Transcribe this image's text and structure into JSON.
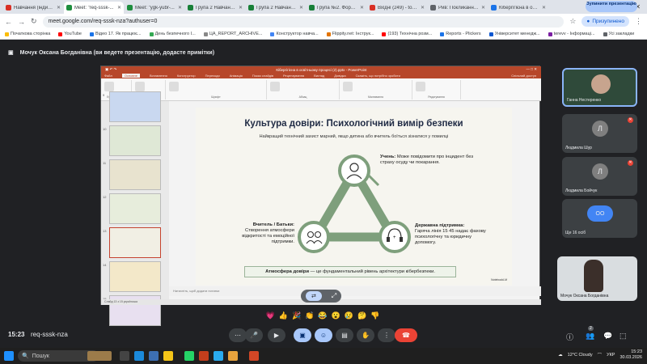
{
  "browser": {
    "tabs": [
      {
        "label": "Навчання (індивід...",
        "color": "#d93025",
        "active": false
      },
      {
        "label": "Meet: \"req-sssk-...",
        "color": "#1e8e3e",
        "active": true
      },
      {
        "label": "Meet: \"ygk-yubr-...",
        "color": "#1e8e3e",
        "active": false
      },
      {
        "label": "Група 2 Навчання (...",
        "color": "#188038",
        "active": false
      },
      {
        "label": "Група 2 Навчання (...",
        "color": "#188038",
        "active": false
      },
      {
        "label": "Група №2. Форма д...",
        "color": "#188038",
        "active": false
      },
      {
        "label": "Вхідні (249) - tokаp...",
        "color": "#d93025",
        "active": false
      },
      {
        "label": "Рив: Покликання на...",
        "color": "#5f6368",
        "active": false
      },
      {
        "label": "Кібергігієна в освіт...",
        "color": "#1a73e8",
        "active": false
      }
    ],
    "url": "meet.google.com/req-sssk-nza?authuser=0",
    "profile": "Призупинено",
    "bookmarks": [
      "Початкова сторінка",
      "YouTube",
      "Відео 17. Як працює...",
      "День безпечного І...",
      "ЦА_REPORT_ARCHIVE...",
      "Конструктор навча...",
      "Flippity.net: Інструк...",
      "(193) Технічна розм...",
      "Reports - Plickers",
      "Університет менедж...",
      "terevv - Інформаці...",
      "Усі закладки"
    ]
  },
  "banner": {
    "text": "Мочук Оксана Богданівна (ви ведете презентацію, додасте примітки)",
    "stop_label": "Зупинити презентацію"
  },
  "ppt": {
    "window_title": "Кібергігієна в освітньому процесі (2).pptx - PowerPoint",
    "menu": [
      "Файл",
      "Основне",
      "Вставлення",
      "Конструктор",
      "Переходи",
      "Анімація",
      "Показ слайдів",
      "Рецензування",
      "Вигляд",
      "Довідка"
    ],
    "search_label": "Скажіть, що потрібно зробити",
    "share_label": "Спільний доступ",
    "ribbon_groups": [
      "Буфер обміну",
      "Слайди",
      "Шрифт",
      "Абзац",
      "Малювання",
      "Редагування"
    ],
    "slide_nums": [
      "9",
      "10",
      "11",
      "12",
      "13",
      "14",
      "15"
    ],
    "notes": "Натисніть, щоб додати нотатки",
    "status": "Слайд 13 з 15   українська"
  },
  "slide": {
    "title": "Культура довіри: Психологічний вимір безпеки",
    "subtitle": "Найкращий технічний захист марний, якщо дитина або вчитель боїться зізнатися у помилці",
    "student_title": "Учень:",
    "student_text": " Може повідомити про інцидент без страху осуду чи покарання.",
    "teacher_title": "Вчитель / Батьки:",
    "teacher_text": "Створення атмосфери відкритості та емоційної підтримки.",
    "state_title": "Державна підтримка:",
    "state_text": "Гаряча лінія 15 45 надає фахову психологічну та юридичну допомогу.",
    "bottom_bold": "Атмосфера довіри",
    "bottom_text": " — це фундаментальний рівень архітектури кібербезпеки.",
    "watermark": "NotebookLM"
  },
  "participants": [
    {
      "name": "Ганна Нестеренко",
      "initial": "",
      "muted": false,
      "video": true
    },
    {
      "name": "Людмила Шур",
      "initial": "Л",
      "muted": true,
      "video": false
    },
    {
      "name": "Людмила Бойчук",
      "initial": "Л",
      "muted": true,
      "video": false
    },
    {
      "name": "Ще 16 осіб",
      "initial": "ОО",
      "muted": false,
      "video": false
    },
    {
      "name": "Мочук Оксана Богданівна",
      "initial": "",
      "muted": false,
      "video": true
    }
  ],
  "meet": {
    "time": "15:23",
    "code": "req-sssk-nza",
    "participant_count": "2"
  },
  "taskbar": {
    "search_label": "Пошук",
    "weather": "12°C  Cloudy",
    "lang": "УКР",
    "time": "15:23",
    "date": "30.03.2026"
  }
}
